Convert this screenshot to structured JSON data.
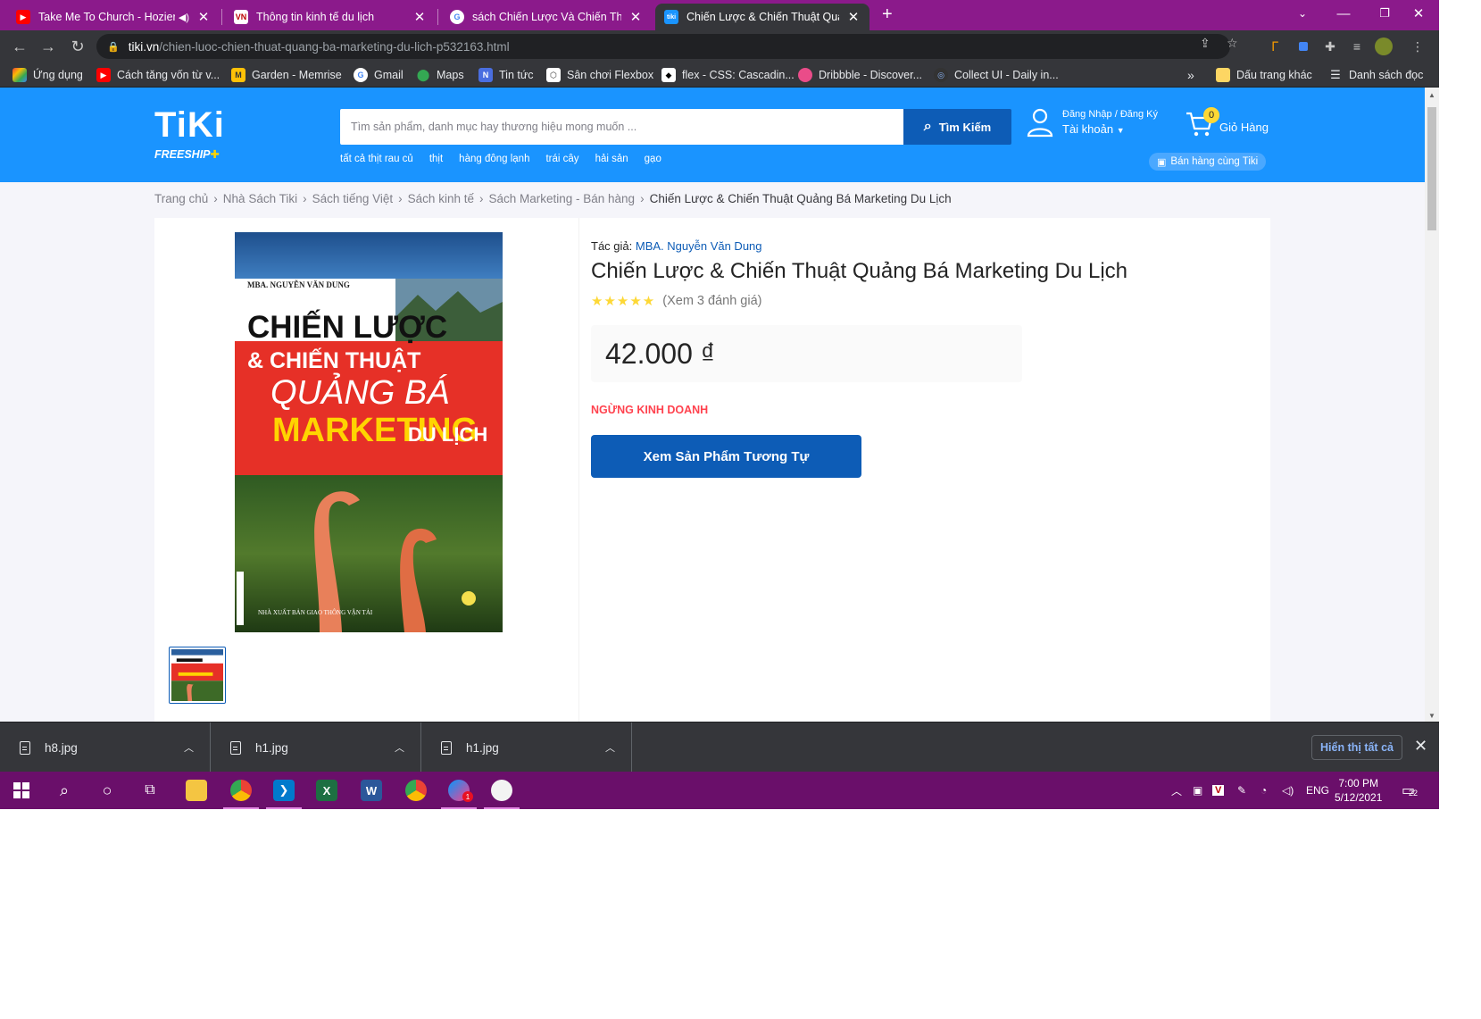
{
  "browser": {
    "tabs": [
      {
        "label": "Take Me To Church - Hozier (",
        "icon": "youtube-icon",
        "audio": "speaker-icon"
      },
      {
        "label": "Thông tin kinh tế du lịch",
        "icon": "vietnam-site-icon"
      },
      {
        "label": "sách Chiến Lược Và Chiến Thuật",
        "icon": "google-icon"
      },
      {
        "label": "Chiến Lược & Chiến Thuật Quảng",
        "icon": "tiki-icon",
        "active": true
      }
    ],
    "tab_icon_text": {
      "vietnam": "VN",
      "tiki": "tiki"
    },
    "new_tab": "+",
    "url_host": "tiki.vn",
    "url_path": "/chien-luoc-chien-thuat-quang-ba-marketing-du-lich-p532163.html",
    "bookmarks": [
      {
        "label": "Ứng dụng",
        "icon": "apps-grid-icon"
      },
      {
        "label": "Cách tăng vốn từ v...",
        "icon": "youtube-icon"
      },
      {
        "label": "Garden - Memrise",
        "icon": "memrise-icon"
      },
      {
        "label": "Gmail",
        "icon": "google-icon"
      },
      {
        "label": "Maps",
        "icon": "maps-pin-icon"
      },
      {
        "label": "Tin tức",
        "icon": "news-icon"
      },
      {
        "label": "Sân chơi Flexbox",
        "icon": "flexbox-icon"
      },
      {
        "label": "flex - CSS: Cascadin...",
        "icon": "stackoverflow-icon"
      },
      {
        "label": "Dribbble - Discover...",
        "icon": "dribbble-icon"
      },
      {
        "label": "Collect UI - Daily in...",
        "icon": "collectui-icon"
      }
    ],
    "bookmark_overflow": "»",
    "other_bookmarks": "Dấu trang khác",
    "reading_list": "Danh sách đọc"
  },
  "tiki": {
    "logo": "TiKi",
    "freeship": "FREESHIP",
    "search_placeholder": "Tìm sản phẩm, danh mục hay thương hiệu mong muốn ...",
    "search_button": "Tìm Kiếm",
    "quick_links": [
      "tất cả thịt rau củ",
      "thịt",
      "hàng đông lạnh",
      "trái cây",
      "hải sản",
      "gạo"
    ],
    "account_top": "Đăng Nhập / Đăng Ký",
    "account_bottom": "Tài khoản",
    "cart_count": "0",
    "cart_label": "Giỏ Hàng",
    "sell_label": "Bán hàng cùng Tiki",
    "colors": {
      "header": "#1a94ff",
      "button": "#0d5cb6",
      "status": "#ff424e"
    }
  },
  "breadcrumb": [
    "Trang chủ",
    "Nhà Sách Tiki",
    "Sách tiếng Việt",
    "Sách kinh tế",
    "Sách Marketing - Bán hàng",
    "Chiến Lược & Chiến Thuật Quảng Bá Marketing Du Lịch"
  ],
  "product": {
    "author_prefix": "Tác giả:",
    "author": "MBA. Nguyễn Văn Dung",
    "title": "Chiến Lược & Chiến Thuật Quảng Bá Marketing Du Lịch",
    "stars": "★★★★★",
    "rating_value": 5,
    "review_link": "(Xem 3 đánh giá)",
    "price": "42.000 ₫",
    "status": "NGỪNG KINH DOANH",
    "similar_button": "Xem Sản Phẩm Tương Tự",
    "cover": {
      "author": "MBA. NGUYỄN VĂN DUNG",
      "line1": "CHIẾN LƯỢC",
      "line2": "& CHIẾN THUẬT",
      "line3": "QUẢNG BÁ",
      "line4a": "MARKETING",
      "line4b": "DU LỊCH",
      "publisher": "NHÀ XUẤT BẢN GIAO THÔNG VẬN TẢI"
    }
  },
  "downloads": {
    "items": [
      "h8.jpg",
      "h1.jpg",
      "h1.jpg"
    ],
    "show_all": "Hiển thị tất cả"
  },
  "taskbar": {
    "language": "ENG",
    "time": "7:00 PM",
    "date": "5/12/2021",
    "notifications": "22",
    "apps": [
      "windows-start-icon",
      "search-icon",
      "cortana-icon",
      "task-view-icon",
      "file-explorer-icon",
      "chrome-icon",
      "vscode-icon",
      "excel-icon",
      "word-icon",
      "chrome-alt-icon",
      "messenger-icon",
      "paint-icon"
    ],
    "app_letters": {
      "excel": "X",
      "word": "W",
      "messenger_badge": "1"
    },
    "tray_letters": {
      "antivirus": "V"
    }
  }
}
